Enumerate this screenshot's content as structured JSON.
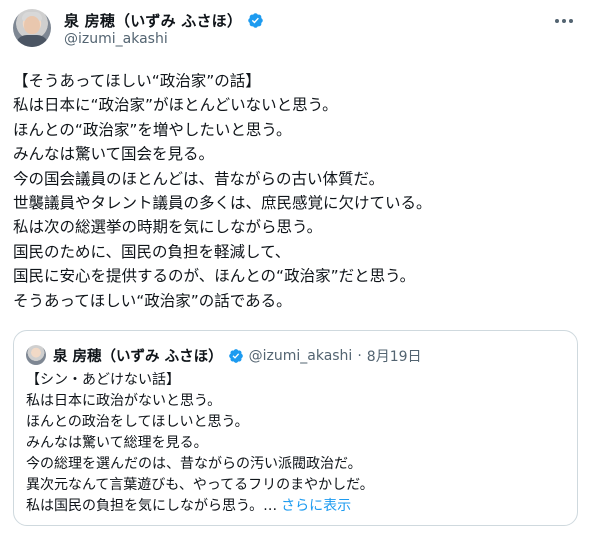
{
  "author": {
    "display_name": "泉 房穂（いずみ ふさほ）",
    "handle": "@izumi_akashi",
    "verified": true,
    "accent_color": "#1d9bf0"
  },
  "tweet": {
    "lines": [
      "【そうあってほしい“政治家”の話】",
      "私は日本に“政治家”がほとんどいないと思う。",
      "ほんとの“政治家”を増やしたいと思う。",
      "みんなは驚いて国会を見る。",
      "今の国会議員のほとんどは、昔ながらの古い体質だ。",
      "世襲議員やタレント議員の多くは、庶民感覚に欠けている。",
      "私は次の総選挙の時期を気にしながら思う。",
      "国民のために、国民の負担を軽減して、",
      "国民に安心を提供するのが、ほんとの“政治家”だと思う。",
      "そうあってほしい“政治家”の話である。"
    ]
  },
  "quoted": {
    "display_name": "泉 房穂（いずみ ふさほ）",
    "handle": "@izumi_akashi",
    "separator": "·",
    "date": "8月19日",
    "lines": [
      "【シン・あどけない話】",
      "私は日本に政治がないと思う。",
      "ほんとの政治をしてほしいと思う。",
      "みんなは驚いて総理を見る。",
      "今の総理を選んだのは、昔ながらの汚い派閥政治だ。",
      "異次元なんて言葉遊びも、やってるフリのまやかしだ。"
    ],
    "last_line": "私は国民の負担を気にしながら思う。…",
    "show_more": "さらに表示"
  },
  "icons": {
    "verified": "verified-badge-icon",
    "more": "more-options-icon"
  }
}
